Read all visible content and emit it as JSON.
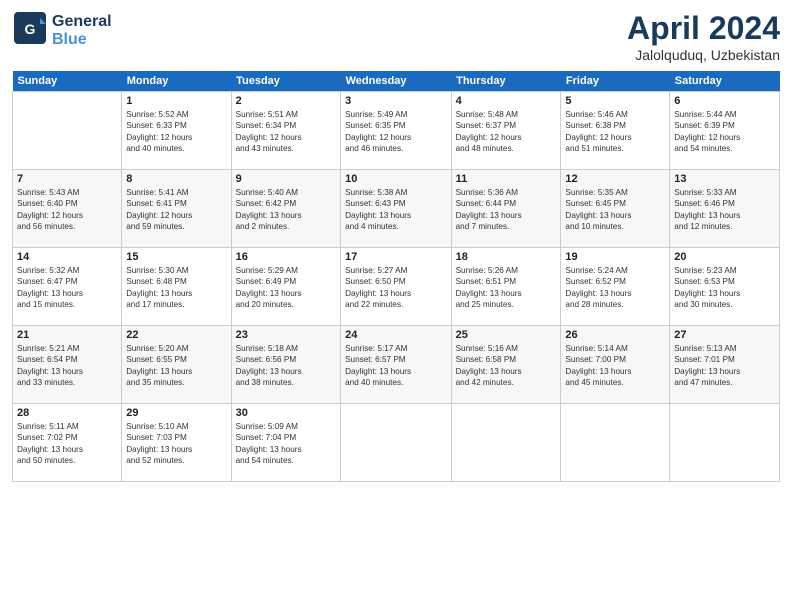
{
  "header": {
    "logo_line1": "General",
    "logo_line2": "Blue",
    "month": "April 2024",
    "location": "Jalolquduq, Uzbekistan"
  },
  "days_of_week": [
    "Sunday",
    "Monday",
    "Tuesday",
    "Wednesday",
    "Thursday",
    "Friday",
    "Saturday"
  ],
  "weeks": [
    [
      {
        "day": "",
        "detail": ""
      },
      {
        "day": "1",
        "detail": "Sunrise: 5:52 AM\nSunset: 6:33 PM\nDaylight: 12 hours\nand 40 minutes."
      },
      {
        "day": "2",
        "detail": "Sunrise: 5:51 AM\nSunset: 6:34 PM\nDaylight: 12 hours\nand 43 minutes."
      },
      {
        "day": "3",
        "detail": "Sunrise: 5:49 AM\nSunset: 6:35 PM\nDaylight: 12 hours\nand 46 minutes."
      },
      {
        "day": "4",
        "detail": "Sunrise: 5:48 AM\nSunset: 6:37 PM\nDaylight: 12 hours\nand 48 minutes."
      },
      {
        "day": "5",
        "detail": "Sunrise: 5:46 AM\nSunset: 6:38 PM\nDaylight: 12 hours\nand 51 minutes."
      },
      {
        "day": "6",
        "detail": "Sunrise: 5:44 AM\nSunset: 6:39 PM\nDaylight: 12 hours\nand 54 minutes."
      }
    ],
    [
      {
        "day": "7",
        "detail": "Sunrise: 5:43 AM\nSunset: 6:40 PM\nDaylight: 12 hours\nand 56 minutes."
      },
      {
        "day": "8",
        "detail": "Sunrise: 5:41 AM\nSunset: 6:41 PM\nDaylight: 12 hours\nand 59 minutes."
      },
      {
        "day": "9",
        "detail": "Sunrise: 5:40 AM\nSunset: 6:42 PM\nDaylight: 13 hours\nand 2 minutes."
      },
      {
        "day": "10",
        "detail": "Sunrise: 5:38 AM\nSunset: 6:43 PM\nDaylight: 13 hours\nand 4 minutes."
      },
      {
        "day": "11",
        "detail": "Sunrise: 5:36 AM\nSunset: 6:44 PM\nDaylight: 13 hours\nand 7 minutes."
      },
      {
        "day": "12",
        "detail": "Sunrise: 5:35 AM\nSunset: 6:45 PM\nDaylight: 13 hours\nand 10 minutes."
      },
      {
        "day": "13",
        "detail": "Sunrise: 5:33 AM\nSunset: 6:46 PM\nDaylight: 13 hours\nand 12 minutes."
      }
    ],
    [
      {
        "day": "14",
        "detail": "Sunrise: 5:32 AM\nSunset: 6:47 PM\nDaylight: 13 hours\nand 15 minutes."
      },
      {
        "day": "15",
        "detail": "Sunrise: 5:30 AM\nSunset: 6:48 PM\nDaylight: 13 hours\nand 17 minutes."
      },
      {
        "day": "16",
        "detail": "Sunrise: 5:29 AM\nSunset: 6:49 PM\nDaylight: 13 hours\nand 20 minutes."
      },
      {
        "day": "17",
        "detail": "Sunrise: 5:27 AM\nSunset: 6:50 PM\nDaylight: 13 hours\nand 22 minutes."
      },
      {
        "day": "18",
        "detail": "Sunrise: 5:26 AM\nSunset: 6:51 PM\nDaylight: 13 hours\nand 25 minutes."
      },
      {
        "day": "19",
        "detail": "Sunrise: 5:24 AM\nSunset: 6:52 PM\nDaylight: 13 hours\nand 28 minutes."
      },
      {
        "day": "20",
        "detail": "Sunrise: 5:23 AM\nSunset: 6:53 PM\nDaylight: 13 hours\nand 30 minutes."
      }
    ],
    [
      {
        "day": "21",
        "detail": "Sunrise: 5:21 AM\nSunset: 6:54 PM\nDaylight: 13 hours\nand 33 minutes."
      },
      {
        "day": "22",
        "detail": "Sunrise: 5:20 AM\nSunset: 6:55 PM\nDaylight: 13 hours\nand 35 minutes."
      },
      {
        "day": "23",
        "detail": "Sunrise: 5:18 AM\nSunset: 6:56 PM\nDaylight: 13 hours\nand 38 minutes."
      },
      {
        "day": "24",
        "detail": "Sunrise: 5:17 AM\nSunset: 6:57 PM\nDaylight: 13 hours\nand 40 minutes."
      },
      {
        "day": "25",
        "detail": "Sunrise: 5:16 AM\nSunset: 6:58 PM\nDaylight: 13 hours\nand 42 minutes."
      },
      {
        "day": "26",
        "detail": "Sunrise: 5:14 AM\nSunset: 7:00 PM\nDaylight: 13 hours\nand 45 minutes."
      },
      {
        "day": "27",
        "detail": "Sunrise: 5:13 AM\nSunset: 7:01 PM\nDaylight: 13 hours\nand 47 minutes."
      }
    ],
    [
      {
        "day": "28",
        "detail": "Sunrise: 5:11 AM\nSunset: 7:02 PM\nDaylight: 13 hours\nand 50 minutes."
      },
      {
        "day": "29",
        "detail": "Sunrise: 5:10 AM\nSunset: 7:03 PM\nDaylight: 13 hours\nand 52 minutes."
      },
      {
        "day": "30",
        "detail": "Sunrise: 5:09 AM\nSunset: 7:04 PM\nDaylight: 13 hours\nand 54 minutes."
      },
      {
        "day": "",
        "detail": ""
      },
      {
        "day": "",
        "detail": ""
      },
      {
        "day": "",
        "detail": ""
      },
      {
        "day": "",
        "detail": ""
      }
    ]
  ]
}
